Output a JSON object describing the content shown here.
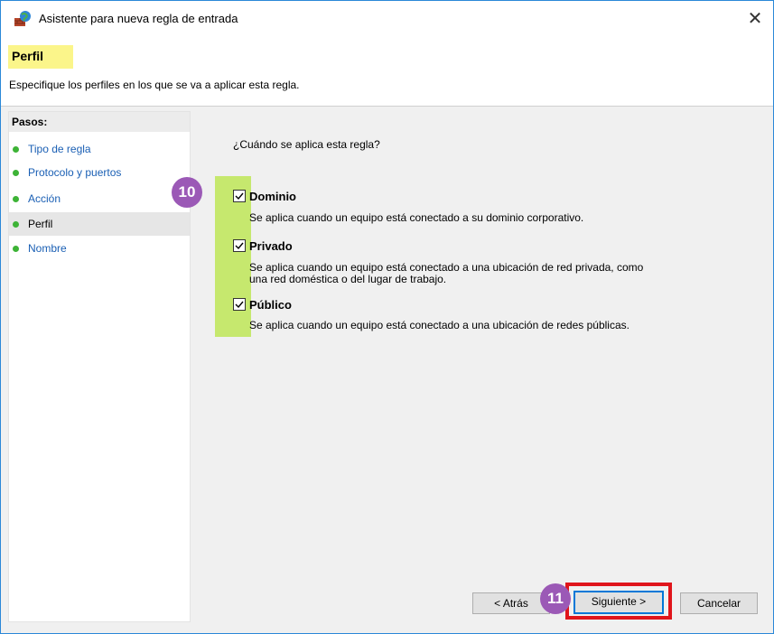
{
  "window": {
    "title": "Asistente para nueva regla de entrada",
    "close_glyph": "✕"
  },
  "header": {
    "title": "Perfil",
    "description": "Especifique los perfiles en los que se va a aplicar esta regla."
  },
  "sidebar": {
    "title": "Pasos:",
    "steps": [
      {
        "label": "Tipo de regla",
        "current": false
      },
      {
        "label": "Protocolo y puertos",
        "current": false
      },
      {
        "label": "Acción",
        "current": false
      },
      {
        "label": "Perfil",
        "current": true
      },
      {
        "label": "Nombre",
        "current": false
      }
    ]
  },
  "content": {
    "question": "¿Cuándo se aplica esta regla?",
    "options": [
      {
        "label": "Dominio",
        "checked": true,
        "description": "Se aplica cuando un equipo está conectado a su dominio corporativo."
      },
      {
        "label": "Privado",
        "checked": true,
        "description_line1": "Se aplica cuando un equipo está conectado a una ubicación de red privada, como",
        "description_line2": "una red doméstica o del lugar de trabajo."
      },
      {
        "label": "Público",
        "checked": true,
        "description": "Se aplica cuando un equipo está conectado a una ubicación de redes públicas."
      }
    ]
  },
  "annotations": {
    "badge_step10": "10",
    "badge_step11": "11",
    "highlight_colors": {
      "yellow": "#fbf58a",
      "green": "#c6e86e",
      "red": "#e0151b",
      "badge": "#9b59b6"
    }
  },
  "footer": {
    "back_label": "< Atrás",
    "next_label": "Siguiente >",
    "cancel_label": "Cancelar"
  },
  "icons": {
    "app": "firewall-globe-icon",
    "step_bullet": "green-dot-icon",
    "checkbox": "checkmark-icon"
  }
}
